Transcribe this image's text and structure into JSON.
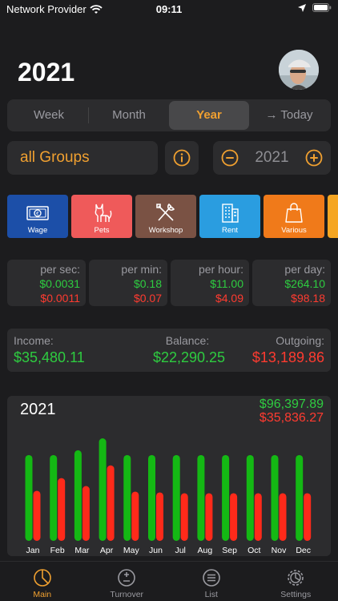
{
  "status": {
    "carrier": "Network Provider",
    "time": "09:11"
  },
  "header": {
    "year": "2021"
  },
  "segments": [
    {
      "label": "Week"
    },
    {
      "label": "Month"
    },
    {
      "label": "Year",
      "active": true
    },
    {
      "label": "→ Today"
    }
  ],
  "controls": {
    "group_label": "all Groups",
    "year_value": "2021"
  },
  "categories": [
    {
      "label": "Wage",
      "color": "#1c4fa8",
      "icon": "banknote-icon"
    },
    {
      "label": "Pets",
      "color": "#ef5a5a",
      "icon": "cat-icon"
    },
    {
      "label": "Workshop",
      "color": "#7a5244",
      "icon": "tools-icon"
    },
    {
      "label": "Rent",
      "color": "#2a9de0",
      "icon": "building-icon"
    },
    {
      "label": "Various",
      "color": "#f07a1a",
      "icon": "shopping-bag-icon"
    }
  ],
  "rates": [
    {
      "label": "per sec:",
      "income": "$0.0031",
      "outgoing": "$0.0011"
    },
    {
      "label": "per min:",
      "income": "$0.18",
      "outgoing": "$0.07"
    },
    {
      "label": "per hour:",
      "income": "$11.00",
      "outgoing": "$4.09"
    },
    {
      "label": "per day:",
      "income": "$264.10",
      "outgoing": "$98.18"
    }
  ],
  "totals": {
    "income_label": "Income:",
    "income": "$35,480.11",
    "balance_label": "Balance:",
    "balance": "$22,290.25",
    "outgoing_label": "Outgoing:",
    "outgoing": "$13,189.86"
  },
  "chart": {
    "year": "2021",
    "total_income": "$96,397.89",
    "total_outgoing": "$35,836.27"
  },
  "chart_data": {
    "type": "bar",
    "categories": [
      "Jan",
      "Feb",
      "Mar",
      "Apr",
      "May",
      "Jun",
      "Jul",
      "Aug",
      "Sep",
      "Oct",
      "Nov",
      "Dec"
    ],
    "series": [
      {
        "values": [
          108,
          108,
          114,
          129,
          108,
          108,
          108,
          108,
          108,
          108,
          108,
          108
        ],
        "color": "#14b814"
      },
      {
        "values": [
          63,
          79,
          69,
          95,
          62,
          61,
          60,
          60,
          60,
          60,
          60,
          60
        ],
        "color": "#ff2a1a"
      }
    ]
  },
  "tabs": [
    {
      "label": "Main",
      "icon": "pie-chart-icon",
      "active": true
    },
    {
      "label": "Turnover",
      "icon": "plus-minus-icon"
    },
    {
      "label": "List",
      "icon": "list-icon"
    },
    {
      "label": "Settings",
      "icon": "gear-icon"
    }
  ]
}
